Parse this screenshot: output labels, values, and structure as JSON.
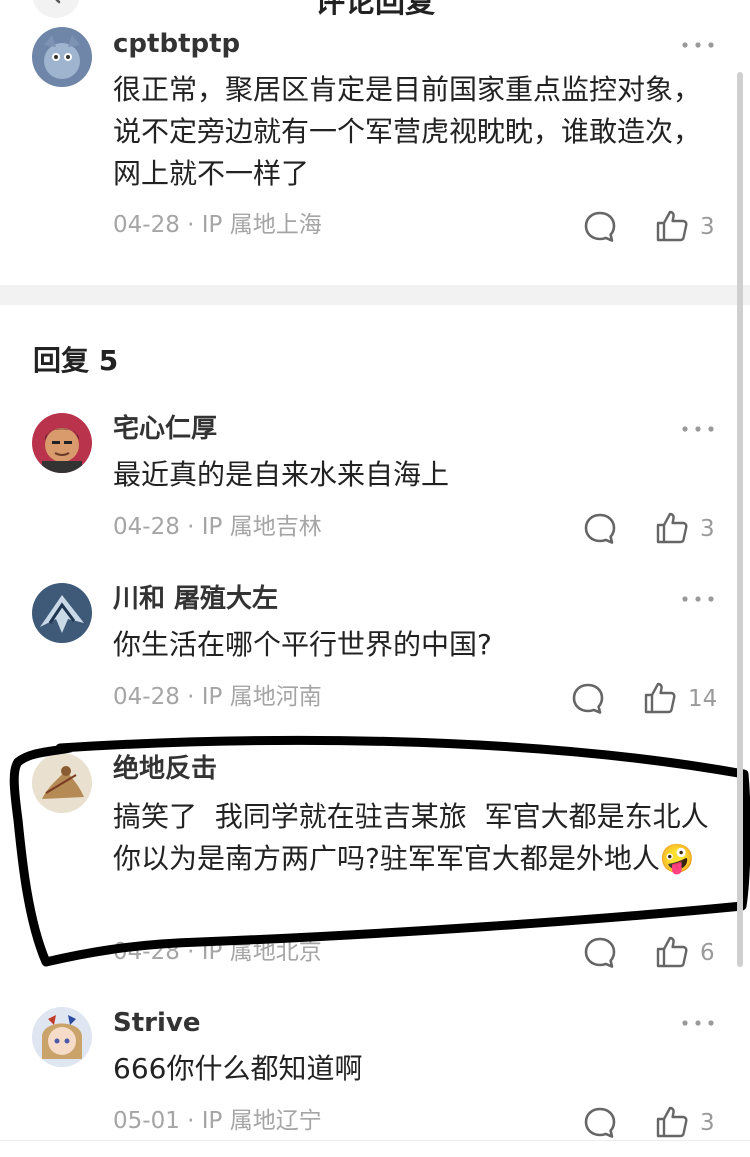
{
  "header": {
    "title": "评论回复",
    "back_icon": "chevron-left-icon"
  },
  "parent_comment": {
    "username": "cptbtptp",
    "content": "很正常，聚居区肯定是目前国家重点监控对象，说不定旁边就有一个军营虎视眈眈，谁敢造次，网上就不一样了",
    "meta": "04-28 · IP 属地上海",
    "likes": "3"
  },
  "replies_title": "回复 5",
  "replies": [
    {
      "username": "宅心仁厚",
      "content": "最近真的是自来水来自海上",
      "meta": "04-28 · IP 属地吉林",
      "likes": "3"
    },
    {
      "username": "川和 屠殖大左",
      "content": "你生活在哪个平行世界的中国?",
      "meta": "04-28 · IP 属地河南",
      "likes": "14"
    },
    {
      "username": "绝地反击",
      "content": "搞笑了  我同学就在驻吉某旅  军官大都是东北人  你以为是南方两广吗?驻军军官大都是外地人",
      "emoji": "🤪",
      "meta": "04-28 · IP 属地北京",
      "likes": "6"
    },
    {
      "username": "Strive",
      "content": "666你什么都知道啊",
      "meta": "05-01 · IP 属地辽宁",
      "likes": "3"
    }
  ],
  "colors": {
    "accent_text": "#222222",
    "meta_text": "#a5a5a5",
    "separator": "#f2f2f2",
    "annotation": "#000000"
  }
}
